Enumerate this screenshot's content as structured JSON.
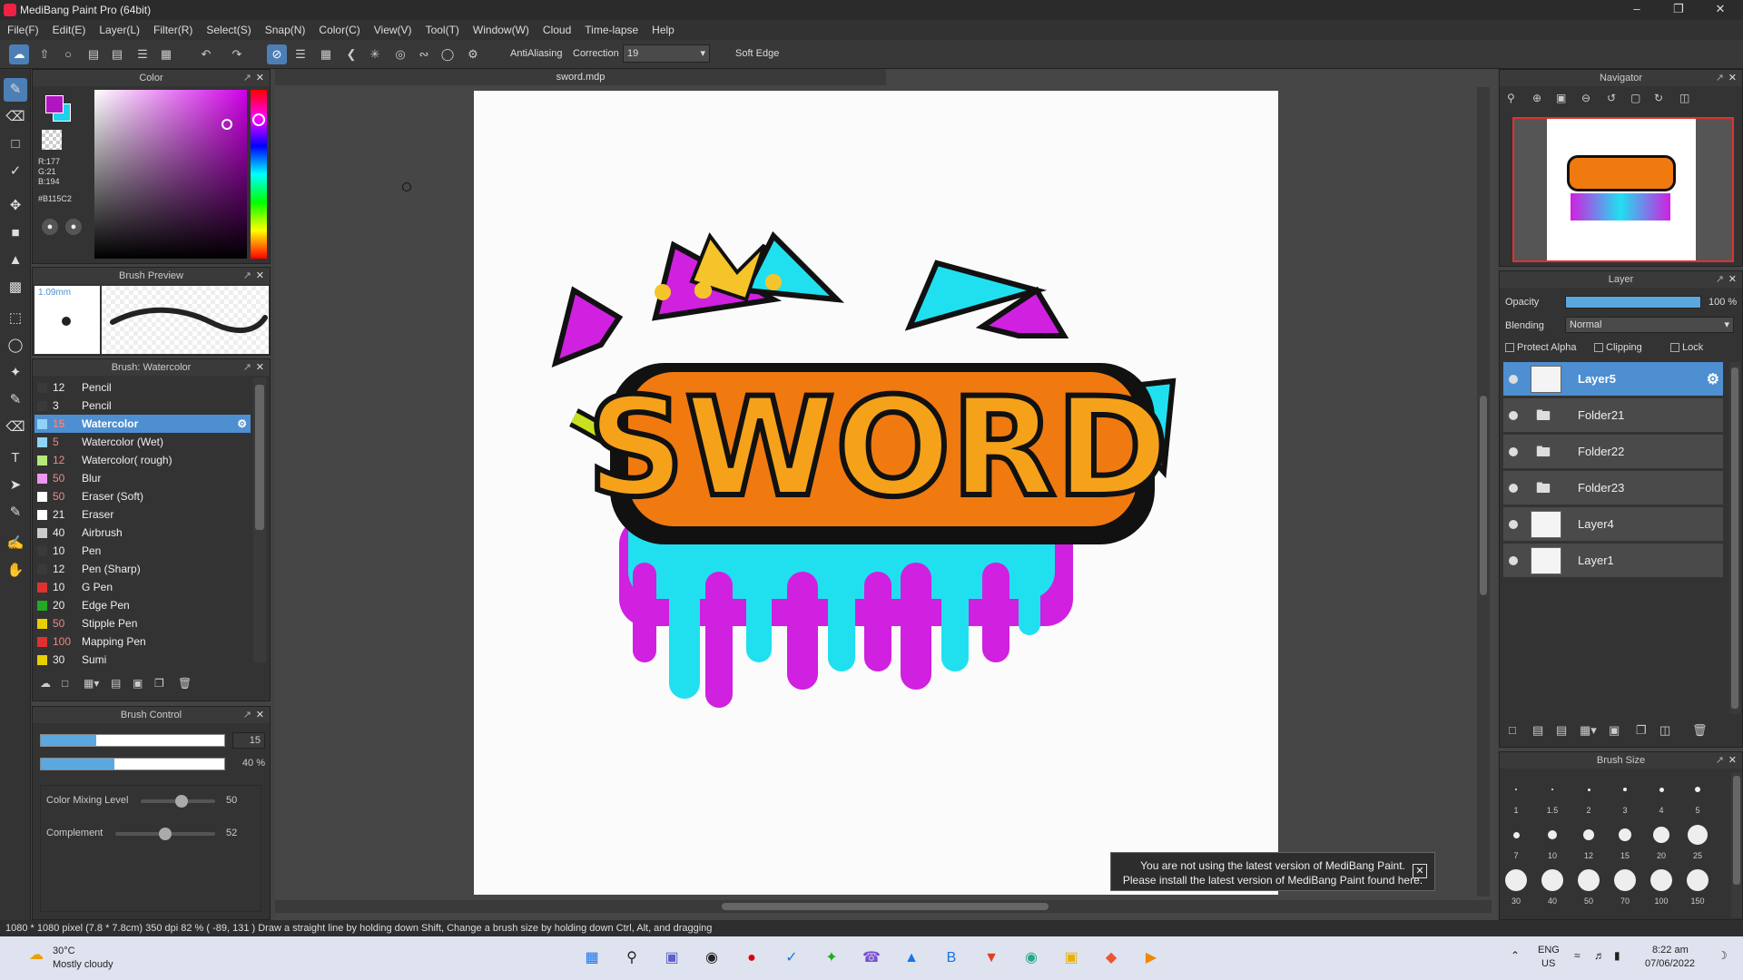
{
  "window": {
    "title": "MediBang Paint Pro (64bit)"
  },
  "menu": [
    "File(F)",
    "Edit(E)",
    "Layer(L)",
    "Filter(R)",
    "Select(S)",
    "Snap(N)",
    "Color(C)",
    "View(V)",
    "Tool(T)",
    "Window(W)",
    "Cloud",
    "Time-lapse",
    "Help"
  ],
  "toolbar": {
    "antialias": "AntiAliasing",
    "correction_label": "Correction",
    "correction_value": "19",
    "soft_edge": "Soft Edge"
  },
  "document": {
    "tab": "sword.mdp"
  },
  "color_panel": {
    "title": "Color",
    "r": "R:177",
    "g": "G:21",
    "b": "B:194",
    "hex": "#B115C2",
    "primary": "#B115C2",
    "secondary": "#1fd0e8"
  },
  "brush_preview": {
    "title": "Brush Preview",
    "size": "1.09mm"
  },
  "brush_list": {
    "title": "Brush: Watercolor",
    "items": [
      {
        "size": "12",
        "name": "Pencil",
        "color": "#3a3a3a"
      },
      {
        "size": "3",
        "name": "Pencil",
        "color": "#3a3a3a"
      },
      {
        "size": "15",
        "name": "Watercolor",
        "color": "#8fd3f5",
        "selected": true
      },
      {
        "size": "5",
        "name": "Watercolor (Wet)",
        "color": "#8fd3f5"
      },
      {
        "size": "12",
        "name": "Watercolor( rough)",
        "color": "#b5e97a"
      },
      {
        "size": "50",
        "name": "Blur",
        "color": "#ef96ef"
      },
      {
        "size": "50",
        "name": "Eraser (Soft)",
        "color": "#ffffff"
      },
      {
        "size": "21",
        "name": "Eraser",
        "color": "#ffffff"
      },
      {
        "size": "40",
        "name": "Airbrush",
        "color": "#cccccc"
      },
      {
        "size": "10",
        "name": "Pen",
        "color": "#3a3a3a"
      },
      {
        "size": "12",
        "name": "Pen (Sharp)",
        "color": "#3a3a3a"
      },
      {
        "size": "10",
        "name": "G Pen",
        "color": "#e03030"
      },
      {
        "size": "20",
        "name": "Edge Pen",
        "color": "#22aa22"
      },
      {
        "size": "50",
        "name": "Stipple Pen",
        "color": "#e8d000"
      },
      {
        "size": "100",
        "name": "Mapping Pen",
        "color": "#e03030"
      },
      {
        "size": "30",
        "name": "Sumi",
        "color": "#e8d000"
      }
    ]
  },
  "brush_control": {
    "title": "Brush Control",
    "size_value": "15",
    "size_fill": 0.3,
    "opacity_value": "40 %",
    "opacity_fill": 0.4,
    "mix_label": "Color Mixing Level",
    "mix_value": "50",
    "mix_pos": 0.55,
    "comp_label": "Complement",
    "comp_value": "52",
    "comp_pos": 0.5
  },
  "navigator": {
    "title": "Navigator"
  },
  "layer_panel": {
    "title": "Layer",
    "opacity_label": "Opacity",
    "opacity_value": "100 %",
    "blending_label": "Blending",
    "blending_value": "Normal",
    "protect_alpha": "Protect Alpha",
    "clipping": "Clipping",
    "lock": "Lock",
    "layers": [
      {
        "name": "Layer5",
        "selected": true
      },
      {
        "name": "Folder21"
      },
      {
        "name": "Folder22"
      },
      {
        "name": "Folder23"
      },
      {
        "name": "Layer4"
      },
      {
        "name": "Layer1"
      }
    ]
  },
  "brush_size": {
    "title": "Brush Size",
    "rows": [
      [
        "1",
        "1.5",
        "2",
        "3",
        "4",
        "5"
      ],
      [
        "7",
        "10",
        "12",
        "15",
        "20",
        "25"
      ],
      [
        "30",
        "40",
        "50",
        "70",
        "100",
        "150"
      ]
    ]
  },
  "notice": {
    "line1": "You are not using the latest version of MediBang Paint.",
    "line2": "Please install the latest version of MediBang Paint found here."
  },
  "status": {
    "text": "1080 * 1080 pixel   (7.8 * 7.8cm)   350 dpi   82 %   ( -89, 131 )   Draw a straight line by holding down Shift, Change a brush size by holding down Ctrl, Alt, and dragging"
  },
  "taskbar": {
    "temp": "30°C",
    "weather": "Mostly cloudy",
    "lang1": "ENG",
    "lang2": "US",
    "time": "8:22 am",
    "date": "07/06/2022"
  },
  "art": {
    "word": "SWORD"
  }
}
